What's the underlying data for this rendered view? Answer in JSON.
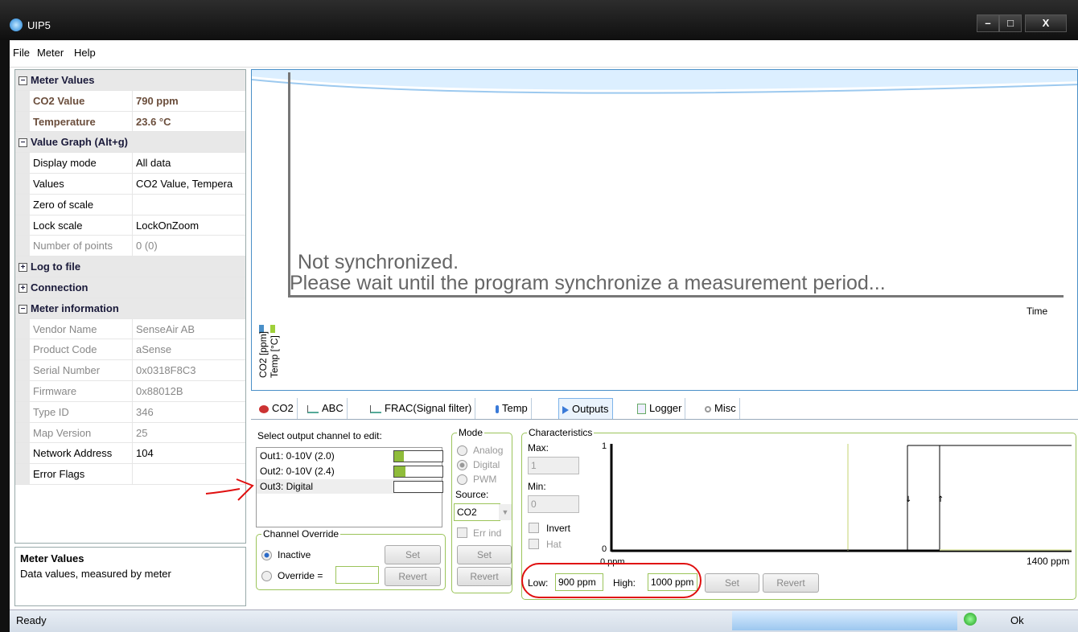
{
  "window": {
    "title": "UIP5"
  },
  "menu": [
    {
      "label": "File"
    },
    {
      "label": "Meter"
    },
    {
      "label": "Help"
    }
  ],
  "propgrid": {
    "meter_values": {
      "title": "Meter Values",
      "co2_label": "CO2 Value",
      "co2_value": "790 ppm",
      "temp_label": "Temperature",
      "temp_value": "23.6 °C"
    },
    "value_graph": {
      "title": "Value Graph (Alt+g)",
      "display_mode_label": "Display mode",
      "display_mode_value": "All data",
      "values_label": "Values",
      "values_value": "CO2 Value, Tempera",
      "zero_label": "Zero of scale",
      "zero_value": "",
      "lock_label": "Lock scale",
      "lock_value": "LockOnZoom",
      "points_label": "Number of points",
      "points_value": "0 (0)"
    },
    "log_to_file": {
      "title": "Log to file"
    },
    "connection": {
      "title": "Connection"
    },
    "meter_info": {
      "title": "Meter information",
      "vendor_label": "Vendor Name",
      "vendor_value": "SenseAir AB",
      "product_label": "Product Code",
      "product_value": "aSense",
      "serial_label": "Serial Number",
      "serial_value": "0x0318F8C3",
      "firmware_label": "Firmware",
      "firmware_value": "0x88012B",
      "type_label": "Type ID",
      "type_value": "346",
      "map_label": "Map Version",
      "map_value": "25",
      "network_label": "Network Address",
      "network_value": "104",
      "error_label": "Error Flags",
      "error_value": ""
    }
  },
  "description": {
    "title": "Meter Values",
    "text": "Data values, measured by meter"
  },
  "graph": {
    "message_line1": "Not synchronized.",
    "message_line2": "Please wait until the program synchronize a measurement period...",
    "time_label": "Time",
    "y_label_1": "CO2 [ppm]",
    "y_label_2": "Temp [°C]"
  },
  "tabs": [
    {
      "label": "CO2"
    },
    {
      "label": "ABC"
    },
    {
      "label": "FRAC(Signal filter)"
    },
    {
      "label": "Temp"
    },
    {
      "label": "Outputs"
    },
    {
      "label": "Logger"
    },
    {
      "label": "Misc"
    }
  ],
  "outputs": {
    "select_label": "Select output channel to edit:",
    "channels": [
      {
        "label": "Out1: 0-10V (2.0)",
        "level": 0.2
      },
      {
        "label": "Out2: 0-10V (2.4)",
        "level": 0.24
      },
      {
        "label": "Out3: Digital",
        "level": 0.0
      }
    ],
    "override": {
      "title": "Channel Override",
      "inactive_label": "Inactive",
      "override_label": "Override =",
      "override_value": "",
      "set_label": "Set",
      "revert_label": "Revert"
    },
    "mode": {
      "title": "Mode",
      "analog_label": "Analog",
      "digital_label": "Digital",
      "pwm_label": "PWM",
      "source_label": "Source:",
      "source_value": "CO2",
      "errind_label": "Err ind",
      "set_label": "Set",
      "revert_label": "Revert"
    },
    "characteristics": {
      "title": "Characteristics",
      "max_label": "Max:",
      "max_value": "1",
      "min_label": "Min:",
      "min_value": "0",
      "invert_label": "Invert",
      "hat_label": "Hat",
      "low_label": "Low:",
      "low_value": "900 ppm",
      "high_label": "High:",
      "high_value": "1000 ppm",
      "set_label": "Set",
      "revert_label": "Revert",
      "chart_y_top": "1",
      "chart_y_bottom": "0",
      "chart_x_left": "0 ppm",
      "chart_x_right": "1400 ppm"
    }
  },
  "status": {
    "text": "Ready",
    "ok_label": "Ok"
  }
}
